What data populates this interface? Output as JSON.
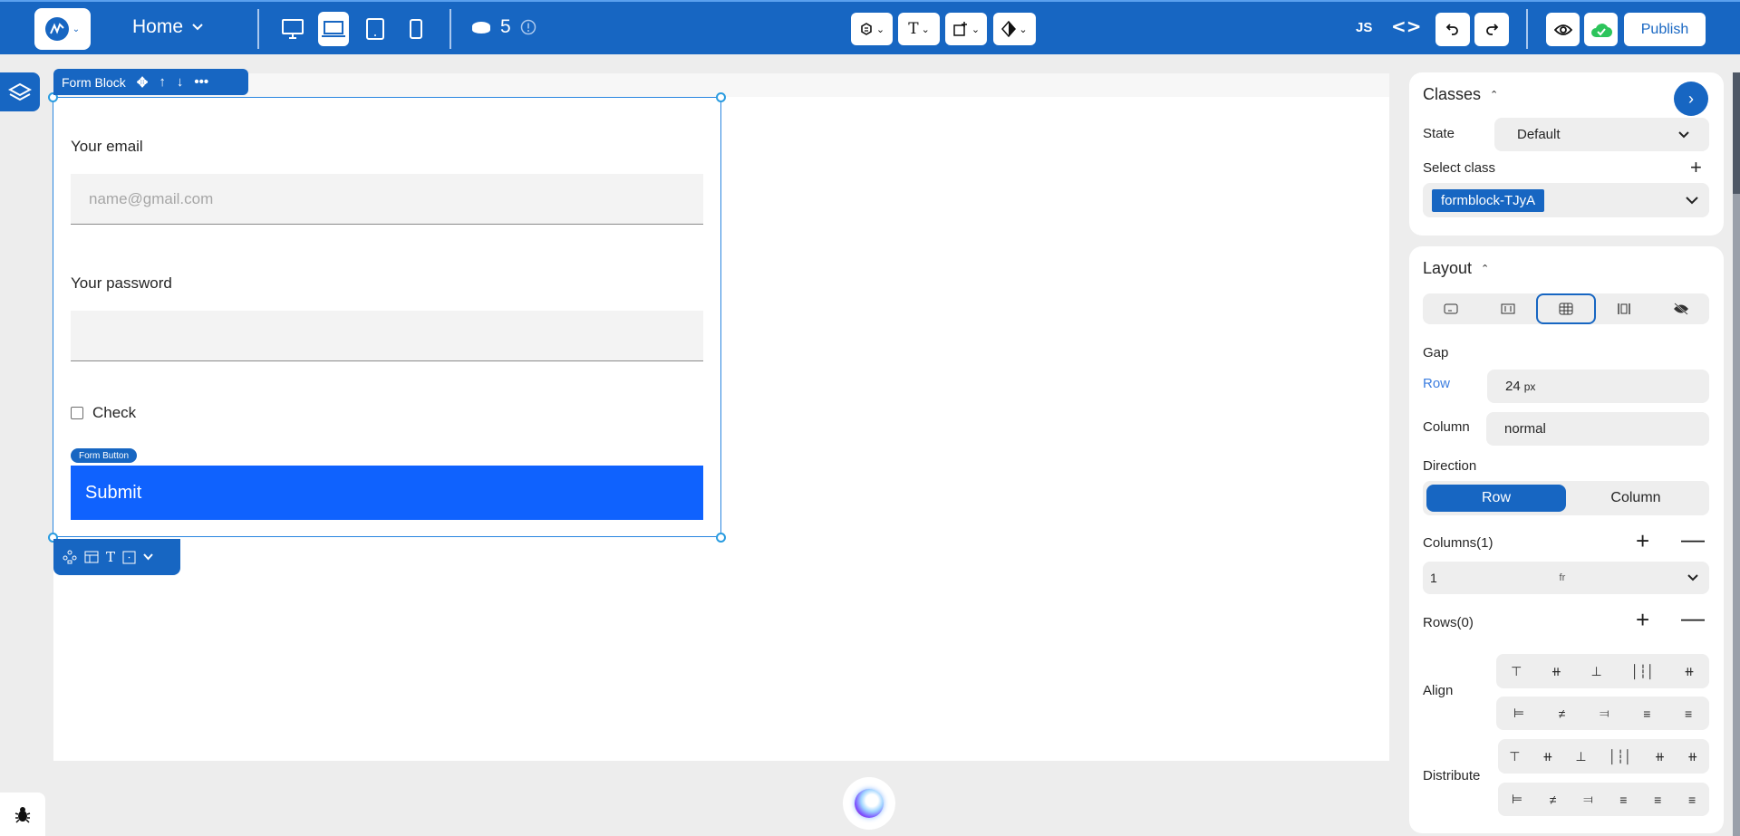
{
  "topbar": {
    "page_name": "Home",
    "devices": [
      {
        "name": "desktop",
        "active": false
      },
      {
        "name": "laptop",
        "active": true
      },
      {
        "name": "tablet",
        "active": false
      },
      {
        "name": "mobile",
        "active": false
      }
    ],
    "pages_count": "5",
    "tools": [
      "component-icon",
      "text-icon",
      "add-box-icon",
      "style-icon"
    ],
    "js_label": "JS",
    "code_label": "<>",
    "publish_label": "Publish",
    "accent_color": "#1766c2"
  },
  "canvas": {
    "selection_label": "Form Block",
    "form": {
      "email_label": "Your email",
      "email_placeholder": "name@gmail.com",
      "password_label": "Your password",
      "password_value": "",
      "checkbox_label": "Check",
      "checkbox_checked": false,
      "button_badge": "Form Button",
      "submit_label": "Submit",
      "submit_color": "#0f62fe"
    }
  },
  "panel": {
    "classes": {
      "title": "Classes",
      "state_label": "State",
      "state_value": "Default",
      "select_class_label": "Select class",
      "selected_class": "formblock-TJyA"
    },
    "layout": {
      "title": "Layout",
      "display_options": [
        "block",
        "flex",
        "grid",
        "inline",
        "none"
      ],
      "active_display": "grid",
      "gap_label": "Gap",
      "row_label": "Row",
      "row_value": "24",
      "row_unit": "px",
      "column_label": "Column",
      "column_value": "normal",
      "direction_label": "Direction",
      "direction_options": [
        "Row",
        "Column"
      ],
      "direction_active": "Row",
      "columns_label": "Columns(1)",
      "columns_value": "1",
      "columns_unit": "fr",
      "rows_label": "Rows(0)",
      "align_label": "Align",
      "distribute_label": "Distribute"
    }
  }
}
